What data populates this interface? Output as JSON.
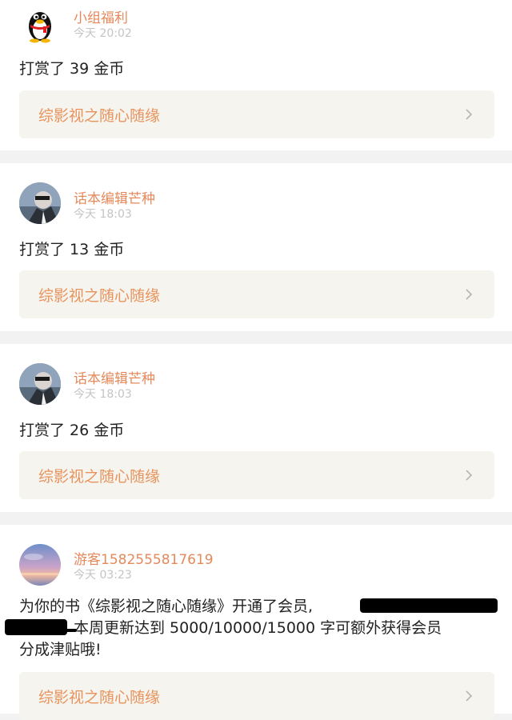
{
  "feed": [
    {
      "author": "小组福利",
      "time": "今天 20:02",
      "message": "打赏了 39 金币",
      "book": "综影视之随心随缘",
      "avatar_icon": "qq-penguin-icon"
    },
    {
      "author": "话本编辑芒种",
      "time": "今天 18:03",
      "message": "打赏了 13 金币",
      "book": "综影视之随心随缘",
      "avatar_icon": "user-photo-avatar"
    },
    {
      "author": "话本编辑芒种",
      "time": "今天 18:03",
      "message": "打赏了 26 金币",
      "book": "综影视之随心随缘",
      "avatar_icon": "user-photo-avatar"
    },
    {
      "author": "游客1582555817619",
      "time": "今天 03:23",
      "message_line1": "为你的书《综影视之随心随缘》开通了会员,",
      "message_line2": "本周更新达到 5000/10000/15000 字可额外获得会员",
      "message_line3": "分成津贴哦!",
      "book": "综影视之随心随缘",
      "avatar_icon": "sunset-sky-avatar"
    }
  ],
  "colors": {
    "accent": "#e5895b",
    "book_bg": "#f5f4ee",
    "page_bg": "#f2f2f2"
  }
}
